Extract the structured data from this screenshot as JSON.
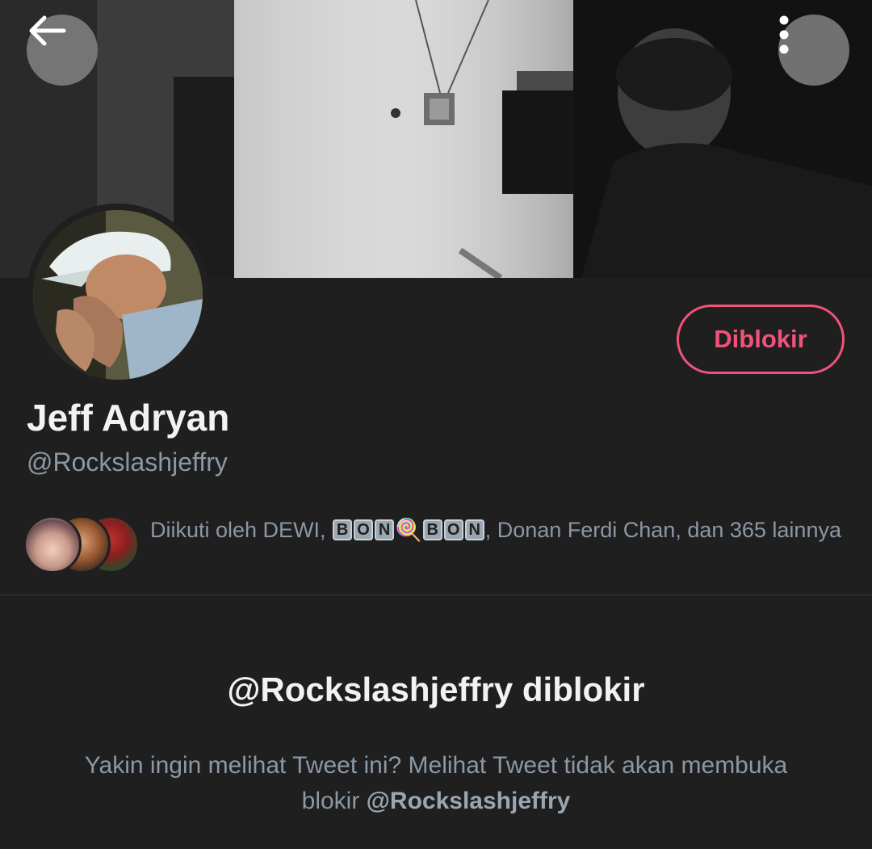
{
  "header": {
    "back_icon": "arrow-left-icon",
    "more_icon": "more-vertical-icon"
  },
  "profile": {
    "display_name": "Jeff Adryan",
    "handle": "@Rockslashjeffry",
    "action_button_label": "Diblokir",
    "action_button_color": "#f0537a"
  },
  "followers": {
    "prefix": "Diikuti oleh DEWI, ",
    "bon_left": [
      "B",
      "O",
      "N"
    ],
    "lollipop": "🍭",
    "bon_right": [
      "B",
      "O",
      "N"
    ],
    "suffix": ", Donan Ferdi Chan, dan 365 lainnya"
  },
  "blocked_notice": {
    "title": "@Rockslashjeffry diblokir",
    "description": "Yakin ingin melihat Tweet ini? Melihat Tweet tidak akan membuka blokir ",
    "description_handle": "@Rockslashjeffry"
  }
}
